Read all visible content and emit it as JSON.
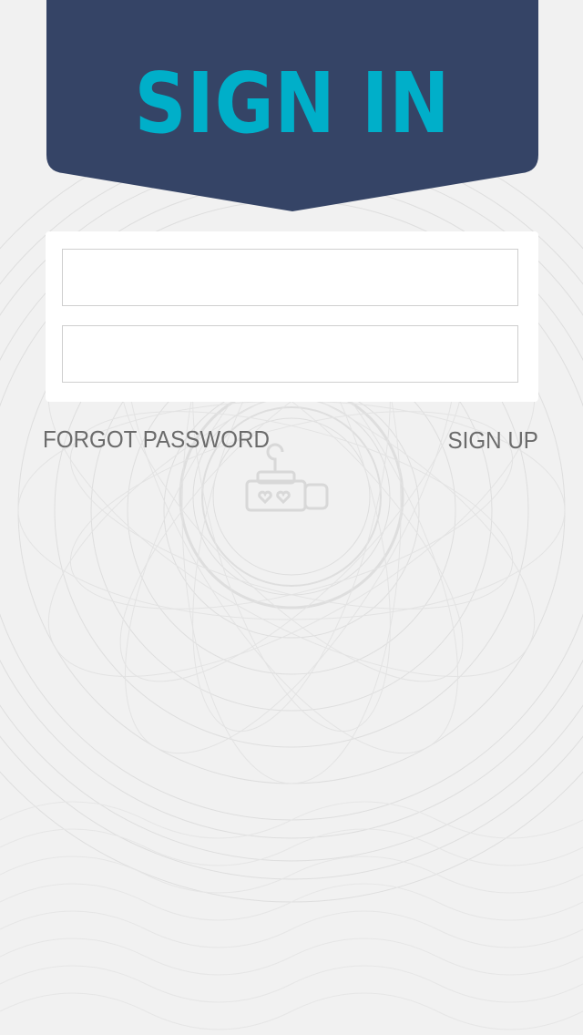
{
  "header": {
    "title": "SIGN IN"
  },
  "form": {
    "username": {
      "value": "",
      "placeholder": ""
    },
    "password": {
      "value": "",
      "placeholder": ""
    }
  },
  "links": {
    "forgot_password": "FORGOT PASSWORD",
    "sign_up": "SIGN UP"
  },
  "colors": {
    "banner": "#354466",
    "accent": "#00afc9",
    "background": "#f1f1f1",
    "link_text": "#6b6b6b"
  },
  "icons": {
    "background_emblem": "slot-machine-icon"
  }
}
